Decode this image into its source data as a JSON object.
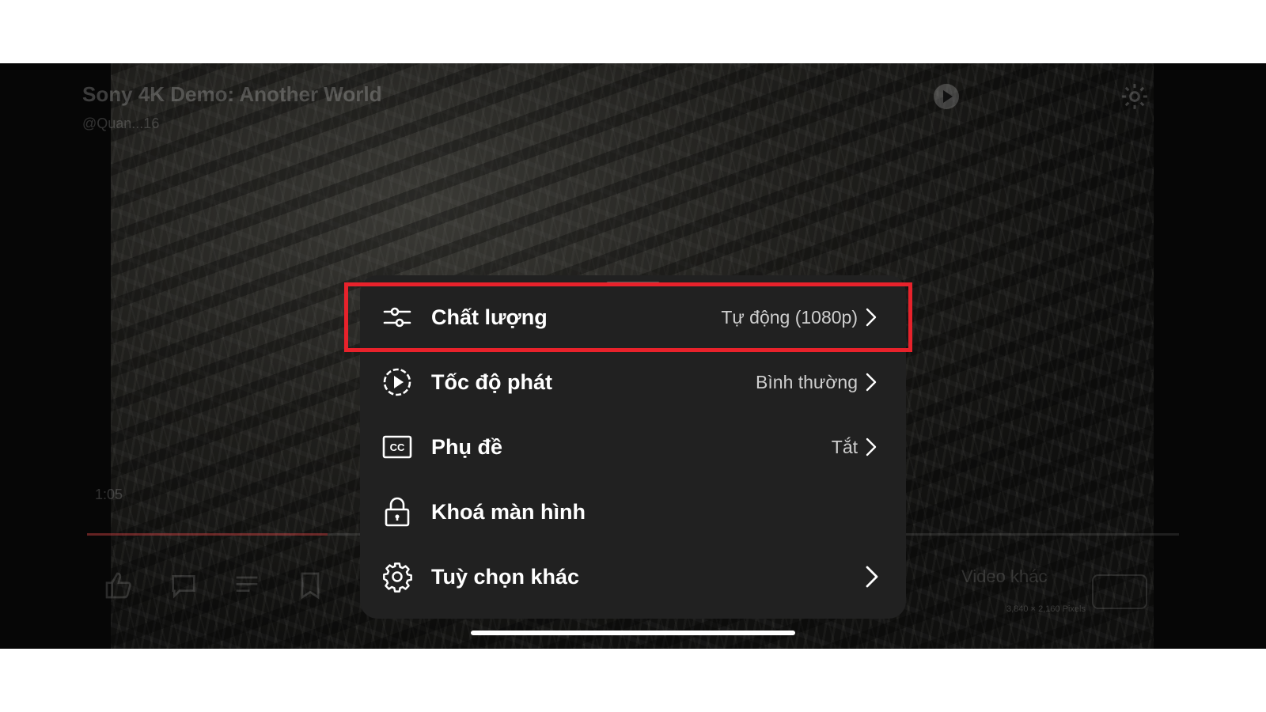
{
  "video": {
    "title": "Sony 4K Demo: Another World",
    "channel": "@Quan...16",
    "timestamp": "1:05",
    "progress": 0.22,
    "more_videos": "Video khác",
    "resolution": "3,840 × 2,160 Pixels"
  },
  "settings_menu": {
    "items": [
      {
        "label": "Chất lượng",
        "value": "Tự động (1080p)",
        "icon": "quality-sliders-icon"
      },
      {
        "label": "Tốc độ phát",
        "value": "Bình thường",
        "icon": "playback-speed-icon"
      },
      {
        "label": "Phụ đề",
        "value": "Tắt",
        "icon": "cc-icon"
      },
      {
        "label": "Khoá màn hình",
        "value": "",
        "icon": "lock-icon"
      },
      {
        "label": "Tuỳ chọn khác",
        "value": "",
        "icon": "gear-icon"
      }
    ]
  },
  "highlight": {
    "color": "#e8222b",
    "target": "Chất lượng"
  }
}
